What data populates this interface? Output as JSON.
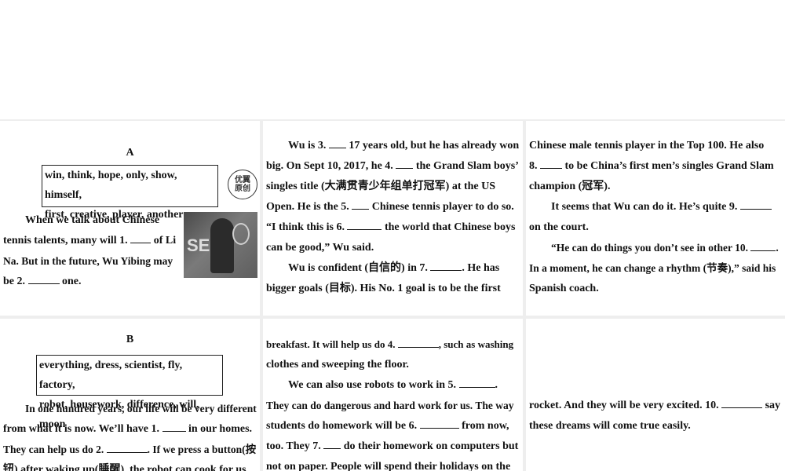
{
  "sectionA": {
    "heading": "A",
    "wordbox_line1": "win, think, hope, only, show, himself,",
    "wordbox_line2": "first, creative, player, another",
    "seal_text": "优翼原创",
    "photo_text": "SE",
    "para1_a": "When we talk about Chinese",
    "para1_b": "tennis talents, many will 1.",
    "para1_c": "of Li",
    "para1_d": "Na. But in the future, Wu Yibing may",
    "para1_e": "be 2.",
    "para1_f": "one."
  },
  "col2": {
    "l1a": "Wu is 3.",
    "l1b": "17 years old, but he has already won",
    "l2a": "big. On Sept 10, 2017, he 4.",
    "l2b": "the Grand Slam boys’",
    "l3": "singles title (大满贯青少年组单打冠军) at the US",
    "l4a": "Open. He is the 5.",
    "l4b": "Chinese tennis player to do so.",
    "l5a": "“I think this is 6.",
    "l5b": "the world that Chinese boys",
    "l6": "can be good,” Wu said.",
    "l7a": "Wu is confident (自信的) in 7.",
    "l7b": ". He has",
    "l8": "bigger goals (目标). His No. 1 goal is to be the first"
  },
  "col3": {
    "l1": "Chinese male tennis player in the Top 100. He also",
    "l2a": "8.",
    "l2b": "to be China’s first men’s singles Grand Slam",
    "l3": "champion (冠军).",
    "l4a": "It seems that Wu can do it. He’s quite 9.",
    "l5": "on the court.",
    "l6a": "“He can do things you don’t see in other 10.",
    "l6b": ".",
    "l7": "In a moment, he can change a rhythm (节奏),” said his",
    "l8": "Spanish coach."
  },
  "sectionB": {
    "heading": "B",
    "wordbox_line1": "everything, dress, scientist, fly, factory,",
    "wordbox_line2": "robot, housework, difference, will, moon",
    "l1": "In one hundred years, our life will be very different",
    "l2a": "from what it is now. We’ll have 1.",
    "l2b": "in our homes.",
    "l3a": "They can help us do 2.",
    "l3b": ". If we press a button(按",
    "l4": "钮) after waking up(睡醒), the robot can cook for us"
  },
  "col5": {
    "l1a": "breakfast. It will help us do 4.",
    "l1b": ", such as washing",
    "l2": "clothes and sweeping the floor.",
    "l3a": "We can also use robots to work in 5.",
    "l3b": ".",
    "l4": "They can do dangerous and hard work for us. The way",
    "l5a": "students do homework will be 6.",
    "l5b": "from now,",
    "l6a": "too. They 7.",
    "l6b": "do their homework on computers but",
    "l7": "not on paper. People will spend their holidays on the"
  },
  "col6": {
    "l1a": "rocket. And they will be very excited. 10.",
    "l1b": "say",
    "l2": "these dreams will come true easily."
  }
}
